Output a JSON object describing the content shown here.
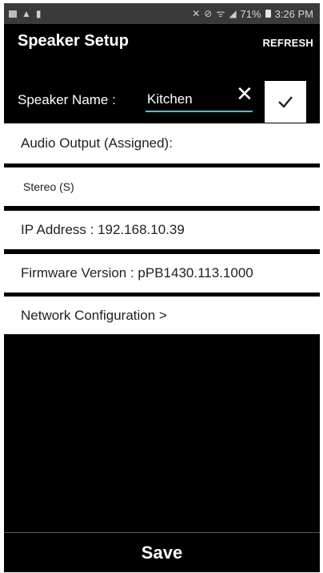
{
  "status_bar": {
    "battery_percent": "71%",
    "time": "3:26 PM"
  },
  "app_bar": {
    "title": "Speaker Setup",
    "refresh_label": "REFRESH"
  },
  "speaker_name": {
    "label": "Speaker Name :",
    "value": "Kitchen"
  },
  "rows": {
    "audio_output": "Audio Output (Assigned):",
    "stereo": "Stereo (S)",
    "ip_address": "IP  Address : 192.168.10.39",
    "firmware": "Firmware  Version : pPB1430.113.1000",
    "network": "Network  Configuration >"
  },
  "save_label": "Save",
  "colors": {
    "accent_underline": "#3fc5d3",
    "background": "#000000",
    "row_background": "#ffffff",
    "status_bar": "#3a3a3a"
  },
  "icons": {
    "clear": "close-icon",
    "confirm": "check-icon"
  }
}
